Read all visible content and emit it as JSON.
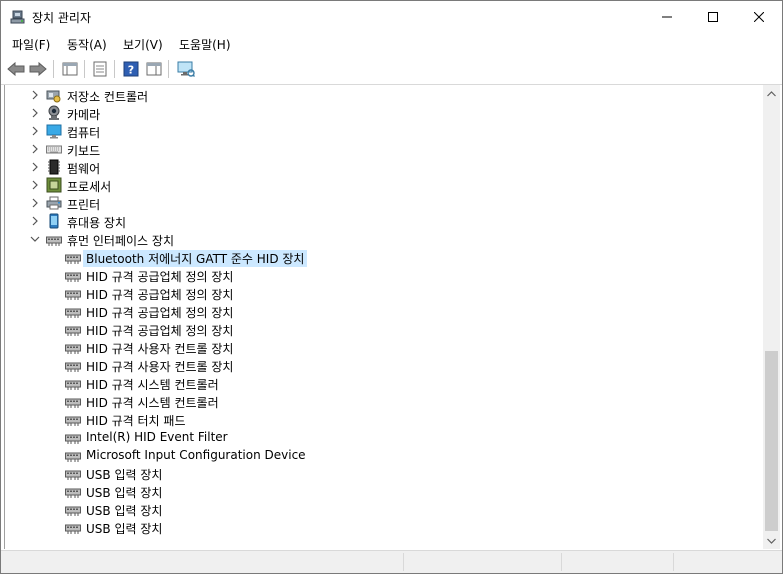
{
  "window": {
    "title": "장치 관리자"
  },
  "menu": [
    "파일(F)",
    "동작(A)",
    "보기(V)",
    "도움말(H)"
  ],
  "tree": {
    "categories": [
      {
        "label": "저장소 컨트롤러",
        "icon": "storage-controller-icon",
        "expanded": false
      },
      {
        "label": "카메라",
        "icon": "camera-icon",
        "expanded": false
      },
      {
        "label": "컴퓨터",
        "icon": "computer-icon",
        "expanded": false
      },
      {
        "label": "키보드",
        "icon": "keyboard-icon",
        "expanded": false
      },
      {
        "label": "펌웨어",
        "icon": "firmware-icon",
        "expanded": false
      },
      {
        "label": "프로세서",
        "icon": "processor-icon",
        "expanded": false
      },
      {
        "label": "프린터",
        "icon": "printer-icon",
        "expanded": false
      },
      {
        "label": "휴대용 장치",
        "icon": "portable-device-icon",
        "expanded": false
      },
      {
        "label": "휴먼 인터페이스 장치",
        "icon": "hid-icon",
        "expanded": true
      }
    ],
    "hid_children": [
      "Bluetooth 저에너지 GATT 준수 HID 장치",
      "HID 규격 공급업체 정의 장치",
      "HID 규격 공급업체 정의 장치",
      "HID 규격 공급업체 정의 장치",
      "HID 규격 공급업체 정의 장치",
      "HID 규격 사용자 컨트롤 장치",
      "HID 규격 사용자 컨트롤 장치",
      "HID 규격 시스템 컨트롤러",
      "HID 규격 시스템 컨트롤러",
      "HID 규격 터치 패드",
      "Intel(R) HID Event Filter",
      "Microsoft Input Configuration Device",
      "USB 입력 장치",
      "USB 입력 장치",
      "USB 입력 장치",
      "USB 입력 장치"
    ],
    "selected_child": 0
  }
}
